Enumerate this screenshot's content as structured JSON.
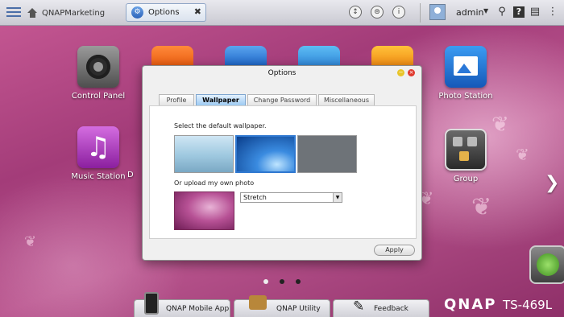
{
  "topbar": {
    "home_label": "QNAPMarketing",
    "active_tab": "Options",
    "username": "admin"
  },
  "desktop_apps": [
    {
      "name": "Control Panel",
      "icon": "gear-icon"
    },
    {
      "name": "Music Station",
      "icon": "music-note-icon"
    },
    {
      "name": "Photo Station",
      "icon": "photo-icon"
    },
    {
      "name": "Group",
      "icon": "group-icon"
    }
  ],
  "partial_label": "D",
  "dialog": {
    "title": "Options",
    "tabs": [
      "Profile",
      "Wallpaper",
      "Change Password",
      "Miscellaneous"
    ],
    "active_tab": "Wallpaper",
    "select_default_text": "Select the default wallpaper.",
    "upload_text": "Or upload my own photo",
    "fit_mode": "Stretch",
    "apply_label": "Apply"
  },
  "pager": {
    "total": 3,
    "current": 1
  },
  "dock": {
    "items": [
      {
        "label": "QNAP Mobile App",
        "icon": "phone-icon"
      },
      {
        "label": "QNAP Utility",
        "icon": "toolbox-icon"
      },
      {
        "label": "Feedback",
        "icon": "edit-icon"
      }
    ]
  },
  "brand": {
    "logo": "QNAP",
    "model": "TS-469L"
  },
  "colors": {
    "accent": "#9cc9f2",
    "background": "#a33c79"
  }
}
